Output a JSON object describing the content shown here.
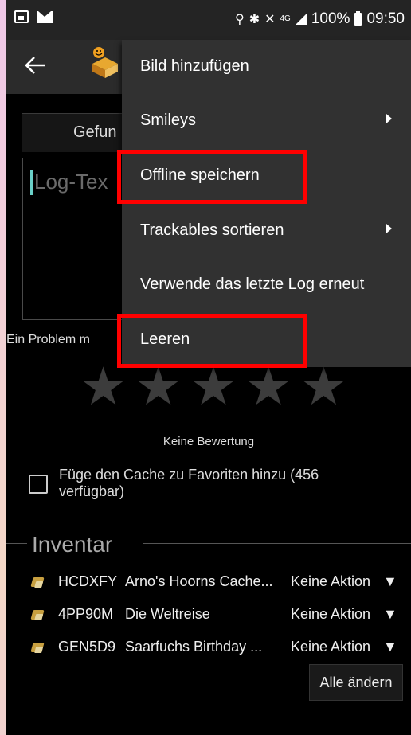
{
  "status_bar": {
    "network": "4G",
    "battery": "100%",
    "time": "09:50"
  },
  "toolbar": {
    "back_icon": "arrow-left-icon",
    "app_icon": "cache-box-icon"
  },
  "overflow_menu": {
    "items": [
      {
        "label": "Bild hinzufügen",
        "has_submenu": false
      },
      {
        "label": "Smileys",
        "has_submenu": true
      },
      {
        "label": "Offline speichern",
        "has_submenu": false
      },
      {
        "label": "Trackables sortieren",
        "has_submenu": true
      },
      {
        "label": "Verwende das letzte Log erneut",
        "has_submenu": false
      },
      {
        "label": "Leeren",
        "has_submenu": false
      }
    ],
    "highlight_color": "#ff0000"
  },
  "log_form": {
    "log_type": "Gefun",
    "log_text_placeholder": "Log-Tex",
    "problem_label": "Ein Problem m",
    "rating": {
      "value": 0,
      "max": 5,
      "label": "Keine Bewertung"
    },
    "favorite_label": "Füge den Cache zu Favoriten hinzu (456 verfügbar)",
    "favorite_checked": false
  },
  "inventory": {
    "title": "Inventar",
    "rows": [
      {
        "code": "HCDXFY",
        "name": "Arno's Hoorns Cache...",
        "action": "Keine Aktion"
      },
      {
        "code": "4PP90M",
        "name": "Die Weltreise",
        "action": "Keine Aktion"
      },
      {
        "code": "GEN5D9",
        "name": "Saarfuchs Birthday ...",
        "action": "Keine Aktion"
      }
    ],
    "change_all_label": "Alle ändern"
  }
}
